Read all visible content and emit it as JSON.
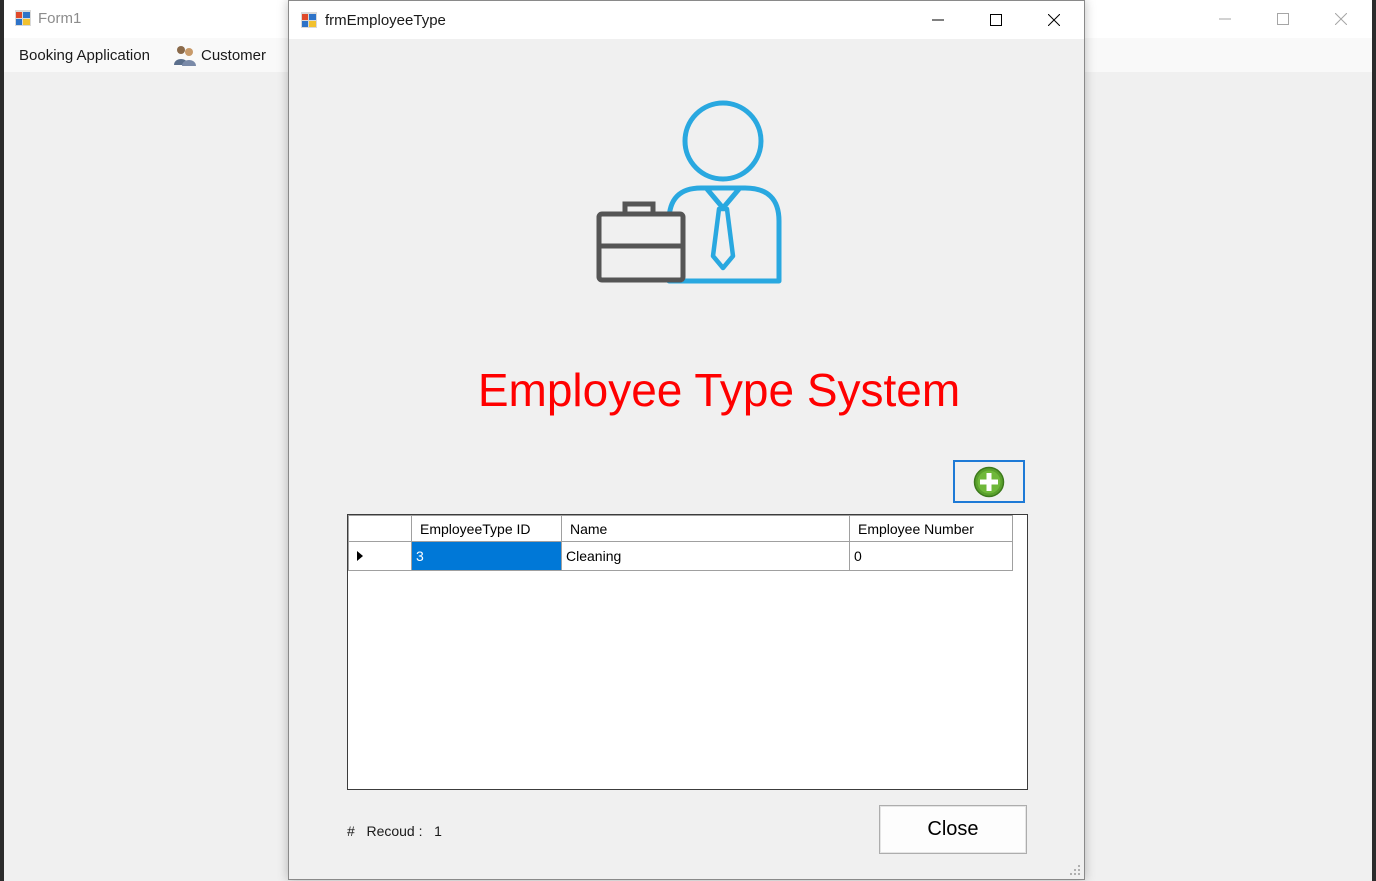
{
  "background_window": {
    "title": "Form1",
    "menu": [
      {
        "label": "Booking Application",
        "icon": null
      },
      {
        "label": "Customer",
        "icon": "customer-people-icon"
      }
    ]
  },
  "dialog": {
    "title": "frmEmployeeType",
    "heading": "Employee Type System",
    "heading_color": "#ff0000",
    "hero_icon": "employee-briefcase-icon",
    "add_button_icon": "green-plus-icon",
    "grid": {
      "columns": [
        "EmployeeType ID",
        "Name",
        "Employee Number"
      ],
      "rows": [
        {
          "id": "3",
          "name": "Cleaning",
          "number": "0"
        }
      ]
    },
    "record_label": "#   Recoud :   1",
    "close_label": "Close"
  },
  "colors": {
    "accent": "#0078d7",
    "icon_blue": "#29a8e0",
    "icon_gray": "#555555",
    "plus_green": "#5aa02c"
  }
}
